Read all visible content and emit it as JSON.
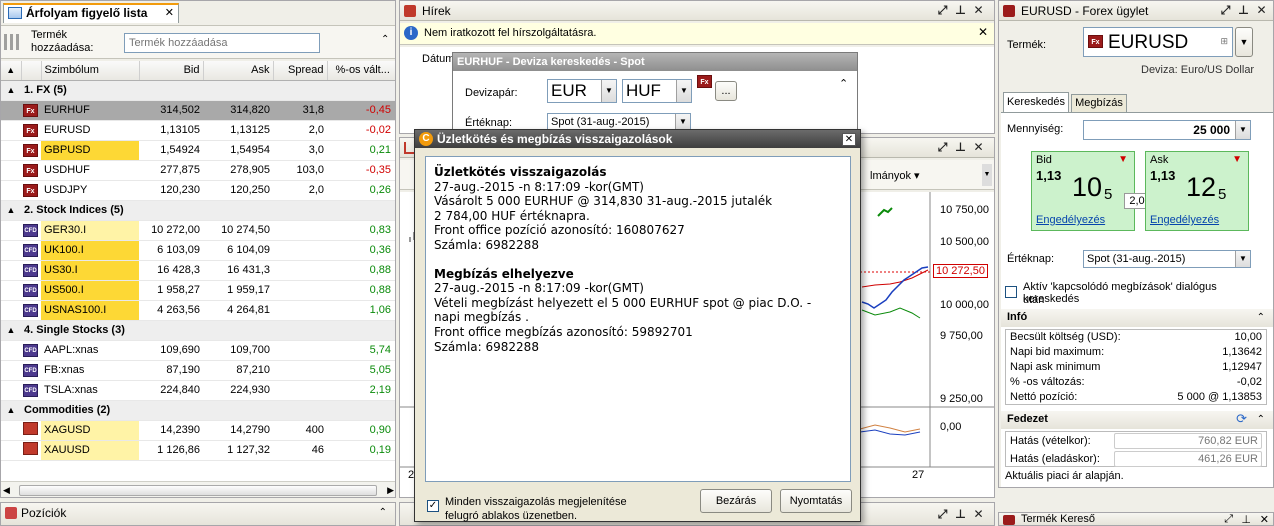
{
  "watchlist": {
    "tab_title": "Árfolyam figyelő lista",
    "add_label": "Termék hozzáadása:",
    "add_placeholder": "Termék hozzáadása",
    "columns": [
      "Szimbólum",
      "Bid",
      "Ask",
      "Spread",
      "%-os vált..."
    ],
    "groups": [
      {
        "name": "1. FX (5)",
        "rows": [
          {
            "icon": "Fx",
            "symbol": "EURHUF",
            "bid": "314,502",
            "ask": "314,820",
            "spread": "31,8",
            "chg": "-0,45",
            "dir": "neg",
            "sel": true
          },
          {
            "icon": "Fx",
            "symbol": "EURUSD",
            "bid": "1,13105",
            "ask": "1,13125",
            "spread": "2,0",
            "chg": "-0,02",
            "dir": "neg"
          },
          {
            "icon": "Fx",
            "symbol": "GBPUSD",
            "bid": "1,54924",
            "ask": "1,54954",
            "spread": "3,0",
            "chg": "0,21",
            "dir": "pos",
            "hl": true
          },
          {
            "icon": "Fx",
            "symbol": "USDHUF",
            "bid": "277,875",
            "ask": "278,905",
            "spread": "103,0",
            "chg": "-0,35",
            "dir": "neg"
          },
          {
            "icon": "Fx",
            "symbol": "USDJPY",
            "bid": "120,230",
            "ask": "120,250",
            "spread": "2,0",
            "chg": "0,26",
            "dir": "pos"
          }
        ]
      },
      {
        "name": "2. Stock Indices (5)",
        "rows": [
          {
            "icon": "CFD",
            "symbol": "GER30.I",
            "bid": "10 272,00",
            "ask": "10 274,50",
            "spread": "",
            "chg": "0,83",
            "dir": "pos",
            "hl2": true
          },
          {
            "icon": "CFD",
            "symbol": "UK100.I",
            "bid": "6 103,09",
            "ask": "6 104,09",
            "spread": "",
            "chg": "0,36",
            "dir": "pos",
            "hl": true
          },
          {
            "icon": "CFD",
            "symbol": "US30.I",
            "bid": "16 428,3",
            "ask": "16 431,3",
            "spread": "",
            "chg": "0,88",
            "dir": "pos",
            "hl": true
          },
          {
            "icon": "CFD",
            "symbol": "US500.I",
            "bid": "1 958,27",
            "ask": "1 959,17",
            "spread": "",
            "chg": "0,88",
            "dir": "pos",
            "hl": true
          },
          {
            "icon": "CFD",
            "symbol": "USNAS100.I",
            "bid": "4 263,56",
            "ask": "4 264,81",
            "spread": "",
            "chg": "1,06",
            "dir": "pos",
            "hl": true
          }
        ]
      },
      {
        "name": "4. Single Stocks (3)",
        "rows": [
          {
            "icon": "CFD",
            "symbol": "AAPL:xnas",
            "bid": "109,690",
            "ask": "109,700",
            "spread": "",
            "chg": "5,74",
            "dir": "pos"
          },
          {
            "icon": "CFD",
            "symbol": "FB:xnas",
            "bid": "87,190",
            "ask": "87,210",
            "spread": "",
            "chg": "5,05",
            "dir": "pos"
          },
          {
            "icon": "CFD",
            "symbol": "TSLA:xnas",
            "bid": "224,840",
            "ask": "224,930",
            "spread": "",
            "chg": "2,19",
            "dir": "pos"
          }
        ]
      },
      {
        "name": "Commodities (2)",
        "rows": [
          {
            "icon": "COM",
            "symbol": "XAGUSD",
            "bid": "14,2390",
            "ask": "14,2790",
            "spread": "400",
            "chg": "0,90",
            "dir": "pos",
            "hl2": true
          },
          {
            "icon": "COM",
            "symbol": "XAUUSD",
            "bid": "1 126,86",
            "ask": "1 127,32",
            "spread": "46",
            "chg": "0,19",
            "dir": "pos",
            "hl2": true
          }
        ]
      }
    ]
  },
  "positions": {
    "title": "Pozíciók"
  },
  "news": {
    "title": "Hírek",
    "info": "Nem iratkozott fel hírszolgáltatásra.",
    "col_date": "Dátum"
  },
  "spot": {
    "title": "EURHUF - Deviza kereskedés - Spot",
    "pair_label": "Devizapár:",
    "base": "EUR",
    "quote": "HUF",
    "value_date_label": "Értéknap:",
    "value_date": "Spot (31-aug.-2015)",
    "fx_icon": "Fx",
    "more_label": "..."
  },
  "chart": {
    "menu_label": "lmányok",
    "y_ticks": [
      "10 750,00",
      "10 500,00",
      "10 000,00",
      "9 750,00",
      "9 250,00"
    ],
    "current_price": "10 272,50",
    "osc_tick": "0,00",
    "date_label": "27",
    "bottom_left": "2"
  },
  "confirm": {
    "title": "Üzletkötés és megbízás visszaigazolások",
    "sections": [
      {
        "heading": "Üzletkötés visszaigazolás",
        "lines": [
          "27-aug.-2015 -n 8:17:09 -kor(GMT)",
          "Vásárolt 5 000 EURHUF @ 314,830 31-aug.-2015 jutalék",
          "2 784,00 HUF értéknapra.",
          "Front office pozíció azonosító: 160807627",
          "Számla: 6982288"
        ]
      },
      {
        "heading": "Megbízás elhelyezve",
        "lines": [
          "27-aug.-2015 -n 8:17:09 -kor(GMT)",
          "Vételi megbízást helyezett el 5 000 EURHUF spot @ piac D.O. -",
          "napi megbízás .",
          "Front office megbízás azonosító: 59892701",
          "Számla: 6982288"
        ]
      }
    ],
    "checkbox_label_1": "Minden visszaigazolás megjelenítése",
    "checkbox_label_2": "felugró ablakos üzenetben.",
    "close_label": "Bezárás",
    "print_label": "Nyomtatás"
  },
  "forex": {
    "title": "EURUSD - Forex ügylet",
    "product_label": "Termék:",
    "product": "EURUSD",
    "currency_note": "Deviza: Euro/US Dollar",
    "tabs": [
      "Kereskedés",
      "Megbízás"
    ],
    "qty_label": "Mennyiség:",
    "qty": "25 000",
    "bid": {
      "label": "Bid",
      "big": "1,13",
      "main": "10",
      "sub": "5",
      "action": "Engedélyezés"
    },
    "ask": {
      "label": "Ask",
      "big": "1,13",
      "main": "12",
      "sub": "5",
      "action": "Engedélyezés"
    },
    "spread": "2,0",
    "value_date_label": "Értéknap:",
    "value_date": "Spot (31-aug.-2015)",
    "related_label_1": "Aktív 'kapcsolódó megbízások' dialógus kereskedés",
    "related_label_2": "után",
    "info_title": "Infó",
    "info_rows": [
      {
        "k": "Becsült költség (USD):",
        "v": "10,00"
      },
      {
        "k": "Napi bid maximum:",
        "v": "1,13642"
      },
      {
        "k": "Napi ask minimum",
        "v": "1,12947"
      },
      {
        "k": "% -os változás:",
        "v": "-0,02"
      },
      {
        "k": "Nettó pozíció:",
        "v": "5 000 @ 1,13853"
      }
    ],
    "margin_title": "Fedezet",
    "margin_rows": [
      {
        "k": "Hatás (vételkor):",
        "v": "760,82 EUR"
      },
      {
        "k": "Hatás (eladáskor):",
        "v": "461,26 EUR"
      }
    ],
    "footer": "Aktuális piaci ár alapján.",
    "finder_title": "Termék Kereső"
  },
  "colors": {
    "accent": "#f29b0c",
    "pos": "#0a8a0a",
    "neg": "#d00000",
    "highlight": "#fdd835"
  }
}
